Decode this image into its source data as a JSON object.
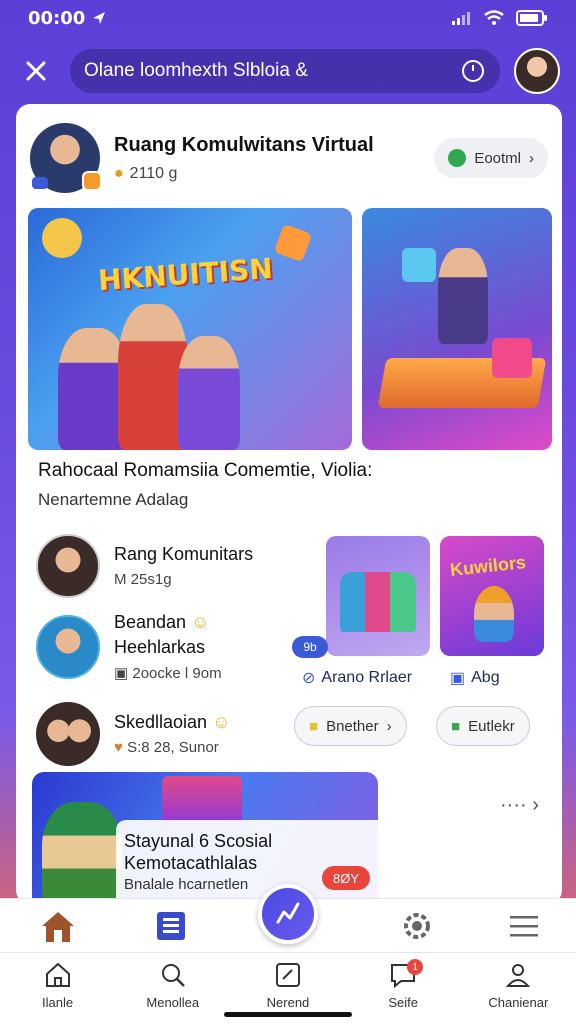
{
  "status_bar": {
    "time": "00:00"
  },
  "top_bar": {
    "search_text": "Olane loomhexth Slbloia &"
  },
  "profile": {
    "name": "Ruang Komulwitans Virtual",
    "sub": "2110 g",
    "follow_label": "Eootml"
  },
  "hero": {
    "title": "HKNUITISN"
  },
  "caption": {
    "title": "Rahocaal Romamsiia Comemtie, Violia:",
    "sub": "Nenartemne Adalag"
  },
  "communities": [
    {
      "name": "Rang Komunitars",
      "sub": "M 25s1g"
    },
    {
      "name": "Beandan",
      "name2": "Heehlarkas",
      "sub": "2oocke l 9om"
    },
    {
      "name": "Skedllaoian",
      "sub": "S:8 28, Sunor"
    }
  ],
  "tiles": [
    {
      "label": "Arano Rrlaer",
      "tag": "9b"
    },
    {
      "label": "Abg",
      "title": "Kuwilors"
    }
  ],
  "pills": [
    {
      "label": "Bnether"
    },
    {
      "label": "Eutlekr"
    }
  ],
  "banner": {
    "title_line1": "Stayunal 6 Scosial",
    "title_line2": "Kemotacathlalas",
    "sub": "Bnalale hcarnetlen",
    "badge": "8ØY"
  },
  "bottom_nav": [
    {
      "label": "Ilanle"
    },
    {
      "label": "Menollea"
    },
    {
      "label": "Nerend"
    },
    {
      "label": "Seife",
      "badge": "1"
    },
    {
      "label": "Chanienar"
    }
  ]
}
